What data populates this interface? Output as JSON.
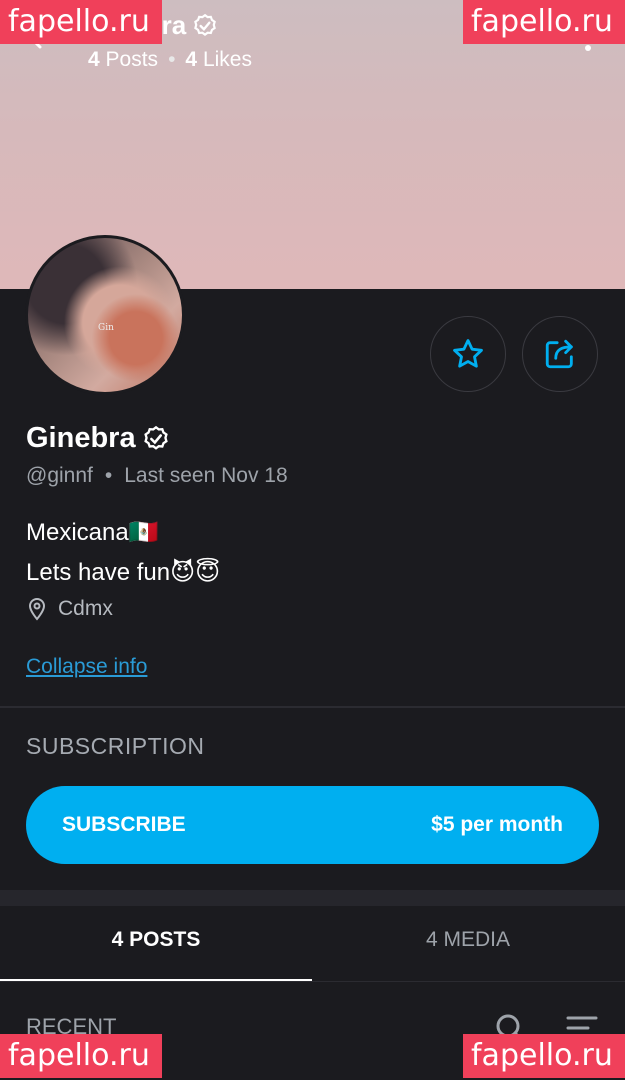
{
  "header": {
    "title": "Ginebra",
    "posts_count": "4",
    "posts_label": "Posts",
    "likes_count": "4",
    "likes_label": "Likes",
    "separator": "•"
  },
  "watermarks": {
    "top_left": "fapello.ru",
    "top_right": "fapello.ru",
    "bottom_left": "fapello.ru",
    "bottom_right": "fapello.ru"
  },
  "avatar": {
    "caption": "Gin"
  },
  "profile": {
    "name": "Ginebra",
    "handle": "@ginnf",
    "separator": "•",
    "last_seen": "Last seen Nov 18",
    "bio_line1": "Mexicana🇲🇽",
    "bio_line2": "Lets have fun😈😇",
    "location": "Cdmx",
    "collapse_label": "Collapse info"
  },
  "subscription": {
    "heading": "SUBSCRIPTION",
    "button_label": "SUBSCRIBE",
    "price": "$5 per month"
  },
  "tabs": [
    {
      "label": "4 POSTS",
      "active": true
    },
    {
      "label": "4 MEDIA",
      "active": false
    }
  ],
  "feed": {
    "section_label": "RECENT"
  },
  "icons": {
    "back": "back-arrow-icon",
    "more": "more-vertical-icon",
    "verified": "verified-badge-icon",
    "favorite": "star-icon",
    "share": "share-icon",
    "location": "location-pin-icon",
    "search": "search-icon",
    "sort": "sort-icon"
  },
  "colors": {
    "accent": "#00aff0",
    "link": "#2a9bd6",
    "background": "#1b1b1f",
    "watermark": "#f0405a"
  }
}
